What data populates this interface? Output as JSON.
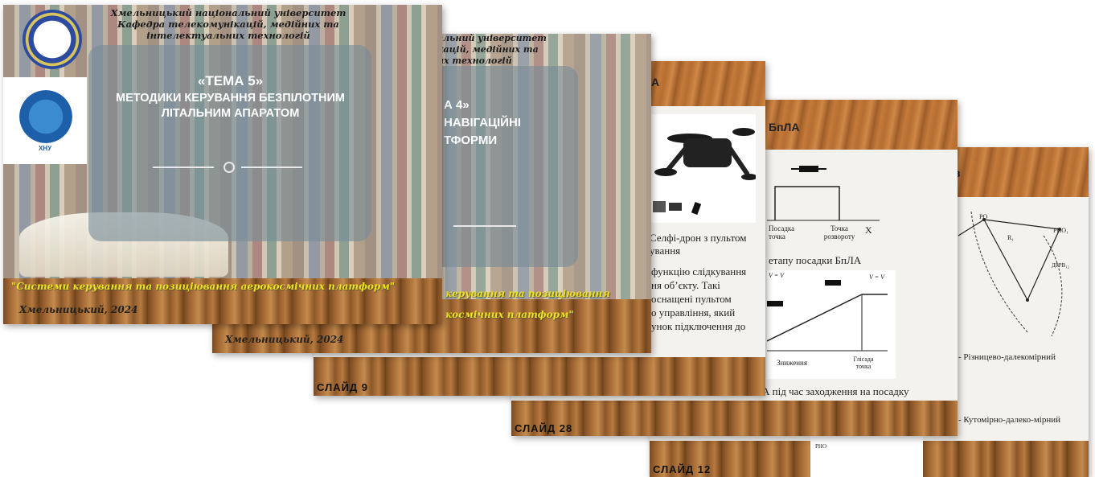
{
  "slide1": {
    "university_line1": "Хмельницький національний університет",
    "university_line2": "Кафедра телекомунікацій, медійних та",
    "university_line3": "інтелектуальних технологій",
    "title_line1": "«ТЕМА 5»",
    "title_line2": "МЕТОДИКИ КЕРУВАННЯ БЕЗПІЛОТНИМ",
    "title_line3": "ЛІТАЛЬНИМ АПАРАТОМ",
    "footer_yellow": "\"Системи керування та позиціювання аерокосмічних платформ\"",
    "city": "Хмельницький, 2024",
    "logo_text": "ХНУ"
  },
  "slide2": {
    "university_line1": "альний університет",
    "university_line2": "кацій, медійних та",
    "university_line3": "их технологій",
    "title_line1": "А 4»",
    "title_line2": "НАВІГАЦІЙНІ",
    "title_line3": "ТФОРМИ",
    "footer_yellow1": "керування та позиціювання",
    "footer_yellow2": "космічних платформ\"",
    "city": "Хмельницький, 2024"
  },
  "slide3": {
    "heading": "А",
    "caption1": "Селфі-дрон з пультом",
    "caption2": "ування",
    "body1": "функцію слідкування",
    "body2": "ня   об’єкту.   Такі",
    "body3": "оснащені    пультом",
    "body4": "о  управління,  який",
    "body5": "унок підключення до",
    "label": "СЛАЙД 9"
  },
  "slide4": {
    "heading": "БпЛА",
    "pt_landing": "Посадка точка",
    "pt_turn": "Точка розвороту",
    "axis_x": "X",
    "h_label": "hₚ",
    "stage": "етапу посадки БпЛА",
    "v_left": "V = V",
    "v_right": "V = V",
    "descent": "Зниження",
    "glide": "Глісада точка",
    "bottom": "А під час заходження на посадку",
    "label": "СЛАЙД 28"
  },
  "slide5": {
    "heading": "в",
    "pt_ro": "РО",
    "pt_r1": "R₁",
    "pt_rno": "РНО₁",
    "pt_dprv": "ДРРВ₁₂",
    "legend1": "- Різницево-далекомірний",
    "legend2": "- Кутомірно-далеко-мірний",
    "label": "СЛАЙД 12",
    "pt_rno2": "РНО"
  },
  "colors": {
    "yellow_text": "#f0e020",
    "panel": "#7a8c96",
    "wood": "#a56a35"
  }
}
